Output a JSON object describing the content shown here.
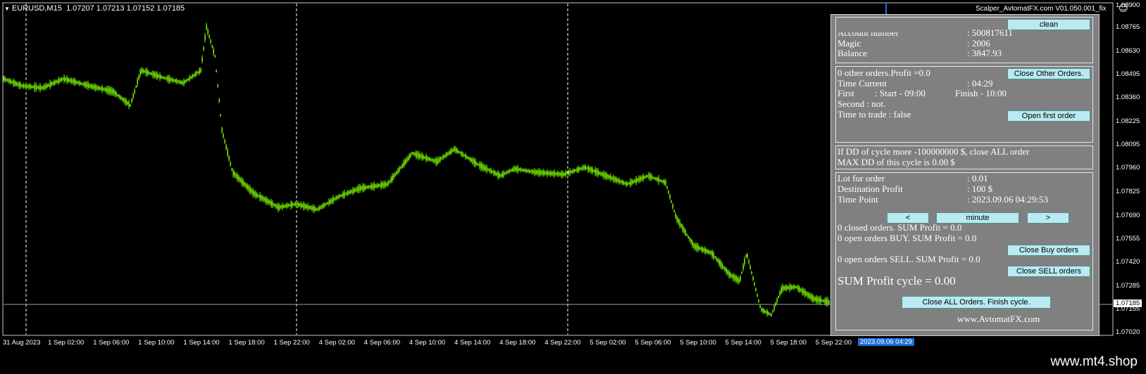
{
  "chart": {
    "symbol": "EURUSD,M15",
    "ohlc": "1.07207 1.07213 1.07152 1.07185",
    "ea_title": "Scalper_AvtomatFX.com  V01.050.001_fix",
    "current_price": "1.07185",
    "current_time": "2023.09.06 04:29",
    "price_labels": [
      "1.08900",
      "1.08765",
      "1.08630",
      "1.08495",
      "1.08360",
      "1.08225",
      "1.08095",
      "1.07960",
      "1.07825",
      "1.07690",
      "1.07555",
      "1.07420",
      "1.07285",
      "1.07155",
      "1.07020"
    ],
    "time_labels": [
      "31 Aug 2023",
      "1 Sep 02:00",
      "1 Sep 06:00",
      "1 Sep 10:00",
      "1 Sep 14:00",
      "1 Sep 18:00",
      "1 Sep 22:00",
      "4 Sep 02:00",
      "4 Sep 06:00",
      "4 Sep 10:00",
      "4 Sep 14:00",
      "4 Sep 18:00",
      "4 Sep 22:00",
      "5 Sep 02:00",
      "5 Sep 06:00",
      "5 Sep 10:00",
      "5 Sep 14:00",
      "5 Sep 18:00",
      "5 Sep 22:00"
    ],
    "colors": {
      "candle": "#7CFC00",
      "background": "#000000",
      "grid": "#ffffff"
    }
  },
  "panel": {
    "clean_label": "clean",
    "account_number_label": "Account number",
    "account_number_value": ": 500817611",
    "magic_label": "Magic",
    "magic_value": ": 2006",
    "balance_label": "Balance",
    "balance_value": ": 3847.93",
    "other_orders_text": "0 other orders.Profit =0.0",
    "close_other_label": "Close Other Orders.",
    "time_current_label": "Time Current",
    "time_current_value": ": 04:29",
    "first_label": "First",
    "first_start": ": Start - 09:00",
    "first_finish": "Finish  - 10:00",
    "second_text": "Second  : not.",
    "time_to_trade_text": "Time to trade :  false",
    "open_first_label": "Open first order",
    "dd_line1": "If DD of cycle more -100000000 $, close ALL order",
    "dd_line2": "MAX DD of this cycle is 0.00 $",
    "lot_label": "Lot for order",
    "lot_value": ": 0.01",
    "dest_label": "Destination Profit",
    "dest_value": ": 100 $",
    "timepoint_label": "Time Point",
    "timepoint_value": ": 2023.09.06 04:29:53",
    "prev_label": "<",
    "minute_label": "minute",
    "next_label": ">",
    "closed_orders_text": "0 closed orders. SUM Profit = 0.0",
    "open_buy_text": "0 open orders BUY. SUM Profit = 0.0",
    "close_buy_label": "Close Buy orders",
    "open_sell_text": "0 open orders SELL. SUM Profit = 0.0",
    "close_sell_label": "Close SELL orders",
    "sum_profit_text": "SUM Profit cycle = 0.00",
    "close_all_label": "Close ALL Orders. Finish cycle.",
    "website": "www.AvtomatFX.com"
  },
  "watermark": "www.mt4.shop"
}
